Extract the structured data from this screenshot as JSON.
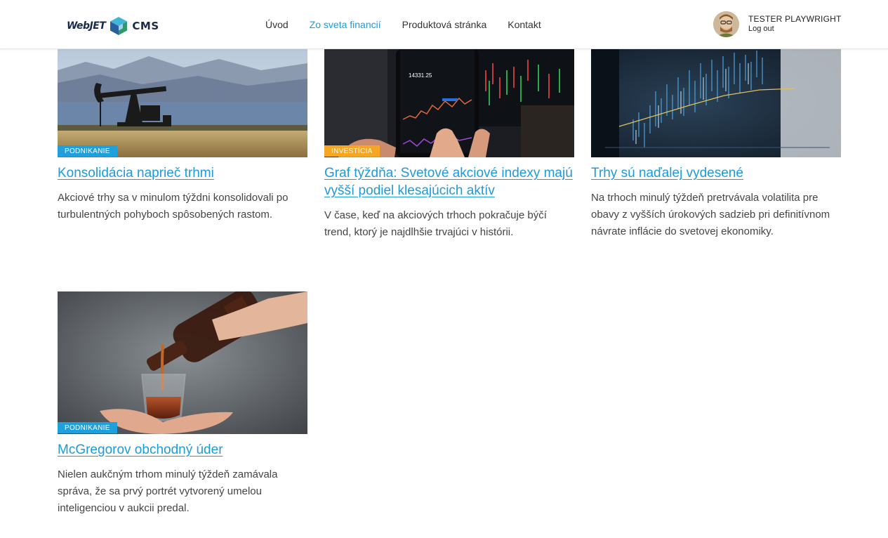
{
  "header": {
    "logo": {
      "left_text": "WebJET",
      "right_text": "CMS"
    },
    "nav": [
      {
        "label": "Úvod",
        "active": false
      },
      {
        "label": "Zo sveta financií",
        "active": true
      },
      {
        "label": "Produktová stránka",
        "active": false
      },
      {
        "label": "Kontakt",
        "active": false
      }
    ],
    "user": {
      "name": "TESTER PLAYWRIGHT",
      "logout_label": "Log out"
    }
  },
  "articles": [
    {
      "category": "PODNIKANIE",
      "category_color": "#1f9fdb",
      "title": "Konsolidácia naprieč trhmi",
      "perex": "Akciové trhy sa v minulom týždni konsolidovali po turbulentných pohyboch spôsobených rastom.",
      "image": "oil-pump-jack"
    },
    {
      "category": "INVESTÍCIA",
      "category_color": "#f5a623",
      "title": "Graf týždňa: Svetové akciové indexy majú vyšší podiel klesajúcich aktív",
      "perex": "V čase, keď na akciových trhoch pokračuje býčí trend, ktorý je najdlhšie trvajúci v histórii.",
      "image": "phone-stock-chart",
      "phone_value": "14331.25"
    },
    {
      "category": "",
      "category_color": "",
      "title": "Trhy sú naďalej vydesené",
      "perex": "Na trhoch minulý týždeň pretrvávala volatilita pre obavy z vyšších úrokových sadzieb pri definitívnom návrate inflácie do svetovej ekonomiky.",
      "image": "candlestick-screen"
    },
    {
      "category": "PODNIKANIE",
      "category_color": "#1f9fdb",
      "title": "McGregorov obchodný úder",
      "perex": "Nielen aukčným trhom minulý týždeň zamávala správa, že sa prvý portrét vytvorený umelou inteligenciou v aukcii predal.",
      "image": "whiskey-pour"
    }
  ]
}
